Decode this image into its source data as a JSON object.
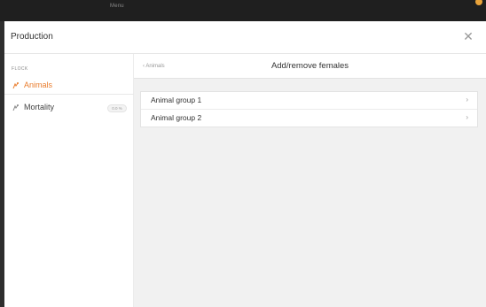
{
  "window": {
    "title": "Menu",
    "accent_color": "#e97c2c"
  },
  "modal": {
    "title": "Production",
    "close_glyph": "✕"
  },
  "sidebar": {
    "section_label": "FLOCK",
    "items": [
      {
        "label": "Animals",
        "icon": "animal-icon",
        "active": true
      },
      {
        "label": "Mortality",
        "icon": "mortality-icon",
        "badge": "0.0 %",
        "active": false
      }
    ]
  },
  "content": {
    "back_label": "‹ Animals",
    "title": "Add/remove females",
    "rows": [
      {
        "label": "Animal group 1",
        "chevron": "›"
      },
      {
        "label": "Animal group 2",
        "chevron": "›"
      }
    ]
  }
}
